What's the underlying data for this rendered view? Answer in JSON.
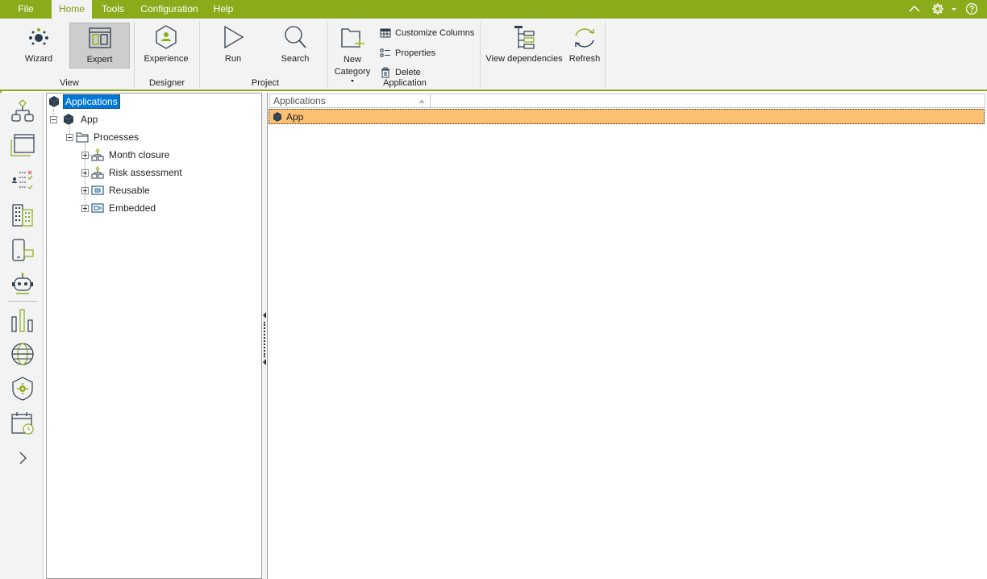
{
  "menu": {
    "file": "File",
    "home": "Home",
    "tools": "Tools",
    "configuration": "Configuration",
    "help": "Help"
  },
  "ribbon": {
    "view": {
      "wizard": "Wizard",
      "expert": "Expert",
      "group": "View"
    },
    "designer": {
      "experience": "Experience",
      "group": "Designer"
    },
    "project": {
      "run": "Run",
      "search": "Search",
      "group": "Project"
    },
    "application": {
      "new_category_line1": "New",
      "new_category_line2": "Category",
      "customize_columns": "Customize Columns",
      "properties": "Properties",
      "delete": "Delete",
      "group": "Application"
    },
    "dependencies": {
      "view_dependencies": "View dependencies",
      "refresh": "Refresh"
    }
  },
  "tree": {
    "root": "Applications",
    "app": "App",
    "processes": "Processes",
    "children": [
      "Month closure",
      "Risk assessment",
      "Reusable",
      "Embedded"
    ]
  },
  "grid": {
    "column": "Applications",
    "rows": [
      "App"
    ]
  },
  "colors": {
    "accent": "#8aac1a",
    "selected_row": "#fdbf72",
    "selected_tree": "#0078d7",
    "icon_dark": "#2d3e4e"
  }
}
